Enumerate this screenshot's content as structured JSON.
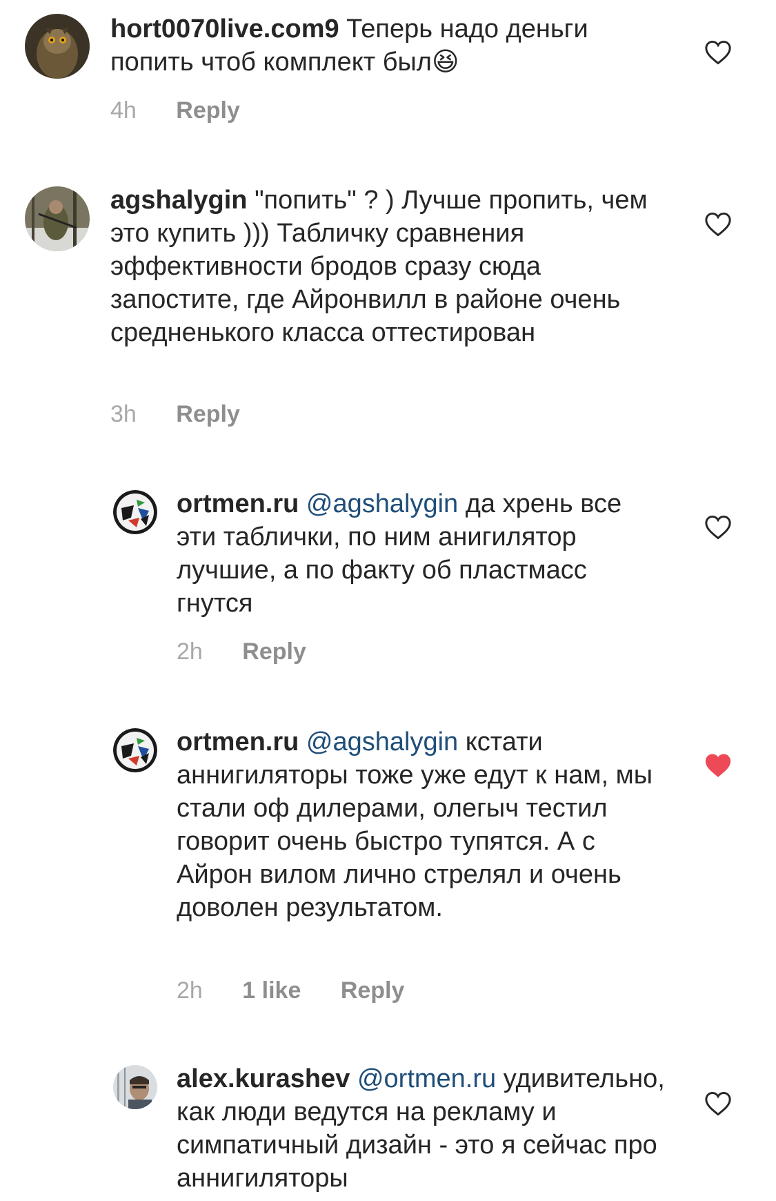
{
  "comments": [
    {
      "username": "hort0070live.com9",
      "mention": "",
      "text": "Теперь надо деньги попить чтоб комплект был",
      "emoji": "😆",
      "time": "4h",
      "likes": "",
      "reply_label": "Reply",
      "liked": false
    },
    {
      "username": "agshalygin",
      "mention": "",
      "text": "\"попить\" ? ) Лучше пропить, чем это купить ))) Табличку сравнения эффективности бродов сразу сюда запостите, где Айронвилл в районе очень средненького класса оттестирован",
      "time": "3h",
      "likes": "",
      "reply_label": "Reply",
      "liked": false
    },
    {
      "username": "ortmen.ru",
      "mention": "@agshalygin",
      "text": "да хрень все эти таблички, по ним анигилятор лучшие, а по факту об пластмасс гнутся",
      "time": "2h",
      "likes": "",
      "reply_label": "Reply",
      "liked": false
    },
    {
      "username": "ortmen.ru",
      "mention": "@agshalygin",
      "text": "кстати аннигиляторы тоже уже едут к нам, мы стали оф дилерами, олегыч тестил говорит очень быстро тупятся. А с Айрон вилом лично стрелял и очень доволен результатом.",
      "time": "2h",
      "likes": "1 like",
      "reply_label": "Reply",
      "liked": true
    },
    {
      "username": "alex.kurashev",
      "mention": "@ortmen.ru",
      "text": "удивительно, как люди ведутся на рекламу и симпатичный дизайн - это я сейчас про аннигиляторы",
      "time": "",
      "likes": "",
      "reply_label": "",
      "liked": false
    }
  ],
  "icons": {
    "heart_outline": "heart-outline-icon",
    "heart_filled": "heart-filled-icon"
  },
  "colors": {
    "text": "#262626",
    "meta": "#8e8e8e",
    "mention": "#1f4e79",
    "liked_heart": "#ed4956"
  }
}
